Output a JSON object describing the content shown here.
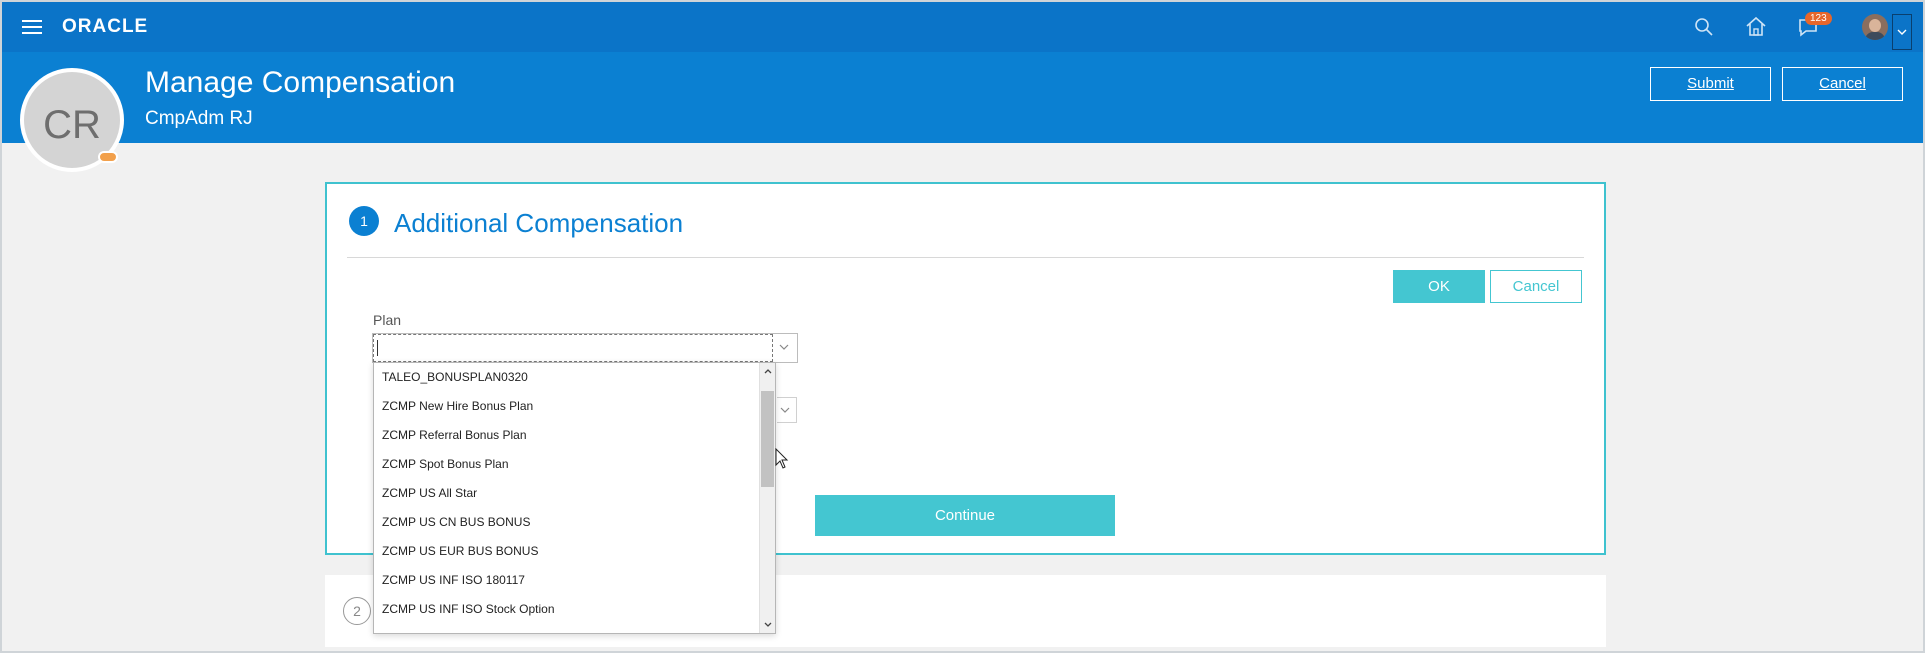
{
  "topbar": {
    "brand": "ORACLE",
    "notification_count": "123",
    "icons": [
      "menu-icon",
      "search-icon",
      "home-icon",
      "notifications-icon",
      "user-avatar"
    ]
  },
  "header": {
    "avatar_initials": "CR",
    "title": "Manage Compensation",
    "subtitle": "CmpAdm RJ",
    "submit_label": "Submit",
    "cancel_label": "Cancel"
  },
  "step1": {
    "number": "1",
    "title": "Additional Compensation",
    "ok_label": "OK",
    "cancel_label": "Cancel",
    "plan_label": "Plan",
    "plan_value": "",
    "continue_label": "Continue"
  },
  "step2": {
    "number": "2"
  },
  "plan_options": [
    "TALEO_BONUSPLAN0320",
    "ZCMP New Hire Bonus Plan",
    "ZCMP Referral Bonus Plan",
    "ZCMP Spot Bonus Plan",
    "ZCMP US All Star",
    "ZCMP US CN BUS BONUS",
    "ZCMP US EUR BUS BONUS",
    "ZCMP US INF ISO 180117",
    "ZCMP US INF ISO Stock Option"
  ],
  "colors": {
    "topbar": "#0b74c8",
    "header": "#0b80d2",
    "accent_teal": "#44c6d1",
    "badge": "#e6662b"
  }
}
